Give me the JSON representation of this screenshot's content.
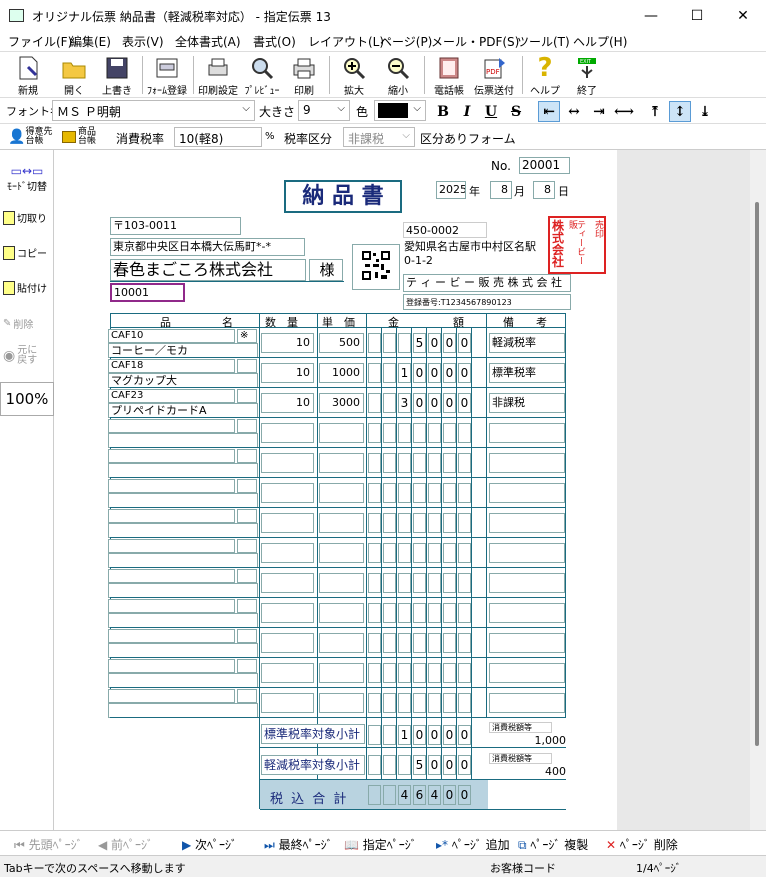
{
  "window": {
    "title": "オリジナル伝票 納品書（軽減税率対応） - 指定伝票 13",
    "min": "—",
    "max": "☐",
    "close": "✕"
  },
  "menu": [
    "ファイル(F)",
    "編集(E)",
    "表示(V)",
    "全体書式(A)",
    "書式(O)",
    "レイアウト(L)",
    "ページ(P)",
    "メール・PDF(S)",
    "ツール(T)",
    "ヘルプ(H)"
  ],
  "toolbar": [
    "新規",
    "開く",
    "上書き",
    "ﾌｫｰﾑ登録",
    "印刷設定",
    "ﾌﾟﾚﾋﾞｭｰ",
    "印刷",
    "拡大",
    "縮小",
    "電話帳",
    "伝票送付",
    "ヘルプ",
    "終了"
  ],
  "fontbar": {
    "font_label": "フォント名",
    "font": "ＭＳ Ｐ明朝",
    "size_label": "大きさ",
    "size": "9",
    "color_label": "色",
    "bold": "B",
    "italic": "I",
    "underline": "U",
    "strike": "S"
  },
  "taxbar": {
    "tokuisaki": "得意先\n台帳",
    "shohin": "商品\n台帳",
    "rate_label": "消費税率",
    "rate": "10(軽8)",
    "pct": "%",
    "kubun_label": "税率区分",
    "kubun": "非課税",
    "form": "区分ありフォーム"
  },
  "sidebar": {
    "mode": "ﾓｰﾄﾞ切替",
    "cut": "切取り",
    "copy": "コピー",
    "paste": "貼付け",
    "delete": "削除",
    "undo": "元に\n戻す",
    "zoom": "100%"
  },
  "doc": {
    "no_label": "No.",
    "no": "20001",
    "title": "納 品 書",
    "year": "2025",
    "year_u": "年",
    "month": "8",
    "month_u": "月",
    "day": "8",
    "day_u": "日",
    "zip": "〒103-0011",
    "addr": "東京都中央区日本橋大伝馬町*-*",
    "company": "春色まごころ株式会社",
    "sama": "様",
    "code": "10001",
    "s_zip": "450-0002",
    "s_addr1": "愛知県名古屋市中村区名駅",
    "s_addr2": "0-1-2",
    "s_name": "テ ィ ー ビ ー 販 売 株 式 会 社",
    "s_reg": "登録番号:T1234567890123",
    "stamp": [
      "株",
      "式",
      "会",
      "社",
      "テ",
      "ィ",
      "ー",
      "ビ",
      "ー",
      "販",
      "売",
      "印"
    ],
    "h_item": "品",
    "h_item2": "名",
    "h_qty": "数　量",
    "h_price": "単　価",
    "h_amount": "金",
    "h_amount2": "額",
    "h_note": "備　　考",
    "rows": [
      {
        "code": "CAF10",
        "name": "コーヒー／モカ",
        "mark": "※",
        "qty": "10",
        "price": "500",
        "amt": [
          "",
          "",
          "5",
          "0",
          "0",
          "0"
        ],
        "note": "軽減税率"
      },
      {
        "code": "CAF18",
        "name": "マグカップ大",
        "mark": "",
        "qty": "10",
        "price": "1000",
        "amt": [
          "",
          "1",
          "0",
          "0",
          "0",
          "0"
        ],
        "note": "標準税率"
      },
      {
        "code": "CAF23",
        "name": "プリペイドカードA",
        "mark": "",
        "qty": "10",
        "price": "3000",
        "amt": [
          "",
          "3",
          "0",
          "0",
          "0",
          "0"
        ],
        "note": "非課税"
      }
    ],
    "std_label": "標準税率対象小計",
    "std_amt": [
      "",
      "1",
      "0",
      "0",
      "0",
      "0"
    ],
    "tax_label1": "消費税額等",
    "tax1": "1,000",
    "red_label": "軽減税率対象小計",
    "red_amt": [
      "",
      "",
      "5",
      "0",
      "0",
      "0"
    ],
    "tax_label2": "消費税額等",
    "tax2": "400",
    "total_label": "税 込 合 計",
    "total_amt": [
      "",
      "4",
      "6",
      "4",
      "0",
      "0"
    ]
  },
  "nav": {
    "first": "先頭ﾍﾟｰｼﾞ",
    "prev": "前ﾍﾟｰｼﾞ",
    "next": "次ﾍﾟｰｼﾞ",
    "last": "最終ﾍﾟｰｼﾞ",
    "goto": "指定ﾍﾟｰｼﾞ",
    "add": "ﾍﾟｰｼﾞ 追加",
    "dup": "ﾍﾟｰｼﾞ 複製",
    "del": "ﾍﾟｰｼﾞ 削除"
  },
  "status": {
    "hint": "Tabキーで次のスペースへ移動します",
    "cust": "お客様コード",
    "page": "1/4ﾍﾟｰｼﾞ"
  }
}
